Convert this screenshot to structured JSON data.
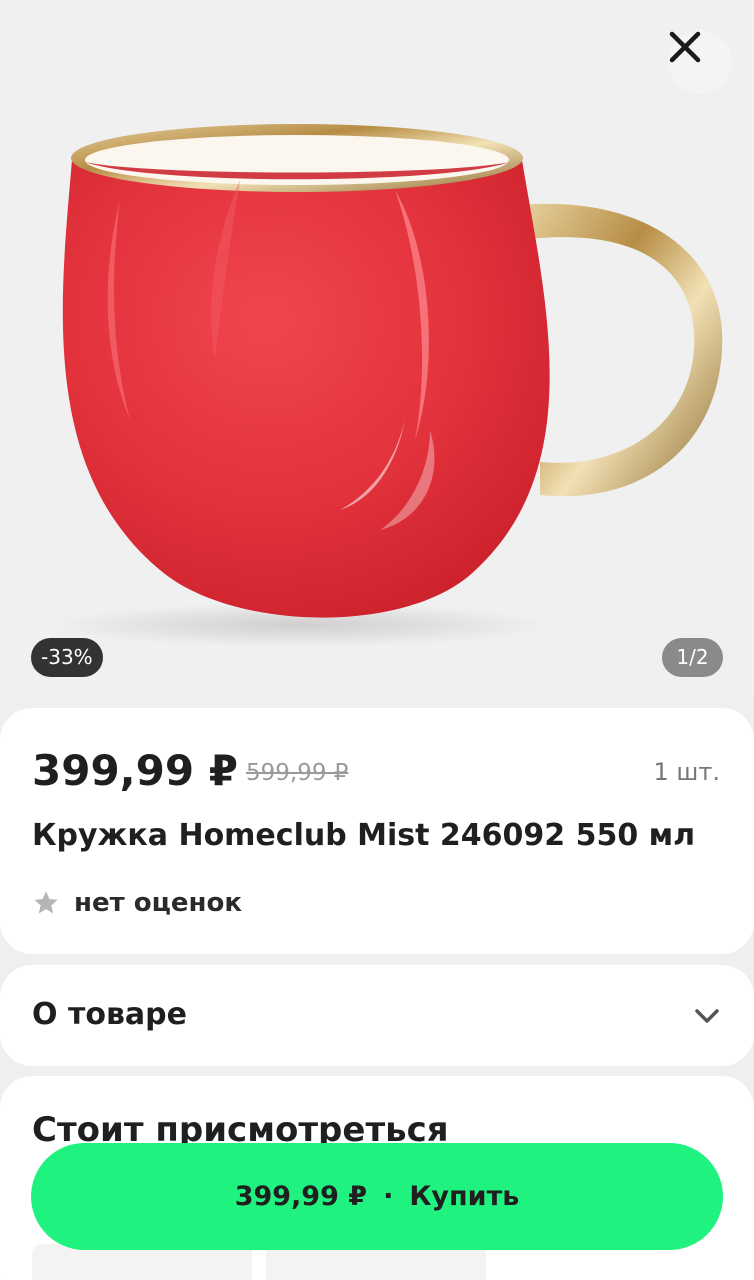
{
  "header": {
    "close_icon": "close-icon",
    "image_counter": "1/2",
    "discount_badge": "-33%"
  },
  "product": {
    "price_current": "399,99 ₽",
    "price_old": "599,99 ₽",
    "quantity": "1 шт.",
    "title": "Кружка Homeclub Mist 246092 550 мл",
    "rating_icon": "star-icon",
    "rating_text": "нет оценок"
  },
  "about": {
    "label": "О товаре",
    "icon": "chevron-down-icon"
  },
  "recommendations": {
    "title": "Стоит присмотреться"
  },
  "buy_button": {
    "price": "399,99 ₽",
    "separator": "·",
    "label": "Купить"
  },
  "colors": {
    "accent": "#20f27f",
    "mug_red": "#e6333d",
    "handle_gold": "#c8a45a"
  }
}
